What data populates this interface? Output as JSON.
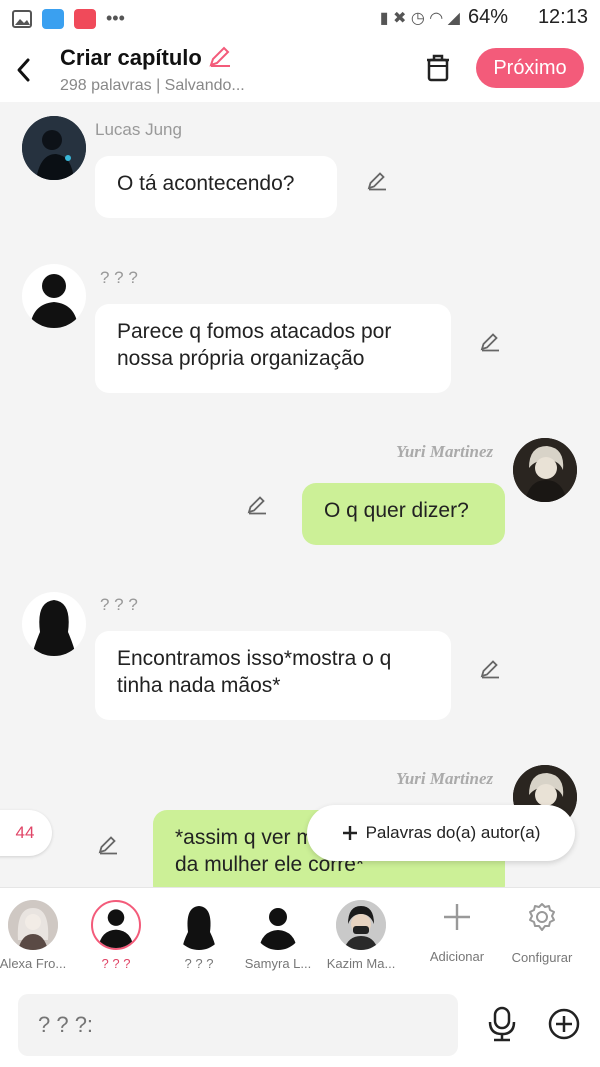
{
  "status_bar": {
    "battery": "64%",
    "time": "12:13"
  },
  "header": {
    "title": "Criar capítulo",
    "subtitle": "298 palavras | Salvando...",
    "next_label": "Próximo"
  },
  "messages": [
    {
      "speaker": "Lucas Jung",
      "side": "left",
      "text": "O tá acontecendo?"
    },
    {
      "speaker": "? ? ?",
      "side": "left",
      "text": "Parece q fomos atacados por nossa própria organização"
    },
    {
      "speaker": "Yuri Martinez",
      "side": "right",
      "text": "O q quer dizer?"
    },
    {
      "speaker": "? ? ?",
      "side": "left",
      "text": "Encontramos isso*mostra o q tinha nada mãos*"
    },
    {
      "speaker": "Yuri Martinez",
      "side": "right",
      "text": "*assim q ver mãos da mulher ele corre*"
    }
  ],
  "word_counter": "44",
  "author_words_label": "Palavras do(a) autor(a)",
  "characters": [
    {
      "label": "Alexa Fro..."
    },
    {
      "label": "? ? ?",
      "selected": true
    },
    {
      "label": "? ? ?"
    },
    {
      "label": "Samyra L..."
    },
    {
      "label": "Kazim Ma..."
    }
  ],
  "add_label": "Adicionar",
  "config_label": "Configurar",
  "input": {
    "placeholder": "? ? ?:"
  },
  "colors": {
    "accent": "#f35b7a",
    "my_bubble": "#ccf097",
    "their_bubble": "#ffffff"
  }
}
